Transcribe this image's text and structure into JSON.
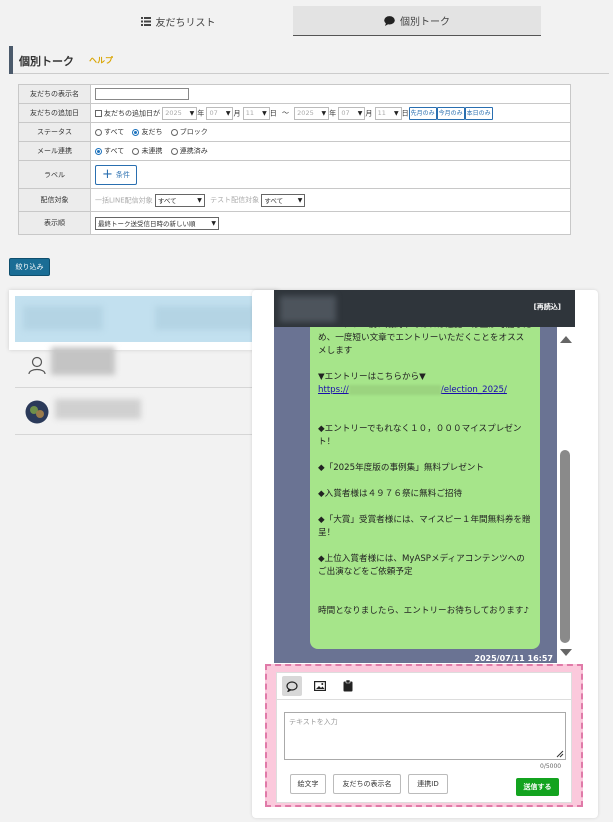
{
  "tabs": [
    {
      "label": "友だちリスト",
      "icon": "list-icon"
    },
    {
      "label": "個別トーク",
      "icon": "chat-bubble-icon"
    }
  ],
  "header": {
    "title": "個別トーク",
    "help": "ヘルプ"
  },
  "filter": {
    "display_name": {
      "label": "友だちの表示名",
      "value": ""
    },
    "add_date": {
      "label": "友だちの追加日",
      "checkbox_label": "友だちの追加日が",
      "from": {
        "year": "2025",
        "year_unit": "年",
        "month": "07",
        "month_unit": "月",
        "day": "11",
        "day_unit": "日"
      },
      "tilde": "～",
      "to": {
        "year": "2025",
        "year_unit": "年",
        "month": "07",
        "month_unit": "月",
        "day": "11",
        "day_unit": "日"
      },
      "buttons": [
        "先月のみ",
        "今月のみ",
        "本日のみ"
      ]
    },
    "status": {
      "label": "ステータス",
      "options": [
        "すべて",
        "友だち",
        "ブロック"
      ],
      "selected": "友だち"
    },
    "mail": {
      "label": "メール連携",
      "options": [
        "すべて",
        "未連携",
        "連携済み"
      ],
      "selected": "すべて"
    },
    "tag": {
      "label": "ラベル",
      "button": "条件"
    },
    "delivery": {
      "label": "配信対象",
      "general_label": "一括LINE配信対象",
      "general_value": "すべて",
      "test_label": "テスト配信対象",
      "test_value": "すべて"
    },
    "order": {
      "label": "表示順",
      "value": "最終トーク送受信日時の新しい順"
    },
    "apply_button": "絞り込み"
  },
  "chat": {
    "reload": "[再読込]",
    "message_lines": [
      "※エントリー後、期間中であれば追記・修正が可能なため、一度短い文章でエントリーいただくことをオススメします",
      "",
      "▼エントリーはこちらから▼",
      "",
      "",
      "◆エントリーでもれなく１０，０００マイスプレゼント！",
      "",
      "◆「2025年度版の事例集」無料プレゼント",
      "",
      "◆入賞者様は４９７６祭に無料ご招待",
      "",
      "◆「大賞」受賞者様には、マイスピー１年間無料券を贈呈！",
      "",
      "◆上位入賞者様には、MyASPメディアコンテンツへのご出演などをご依頼予定",
      "",
      "",
      "時間となりましたら、エントリーお待ちしております♪"
    ],
    "link_prefix": "https://",
    "link_suffix": "/election_2025/",
    "timestamp": "2025/07/11 16:57"
  },
  "composer": {
    "placeholder": "テキストを入力",
    "counter": "0/5000",
    "buttons": [
      "絵文字",
      "友だちの表示名",
      "連携ID"
    ],
    "send": "送信する",
    "tool_icons": [
      "speech-bubble-icon",
      "image-icon",
      "clipboard-icon"
    ]
  },
  "colors": {
    "accent_blue": "#1a6d95",
    "bubble_green": "#a6e58a",
    "chat_bg": "#6a7393",
    "send_green": "#13a31f",
    "highlight_pink": "#fbc9dc"
  }
}
